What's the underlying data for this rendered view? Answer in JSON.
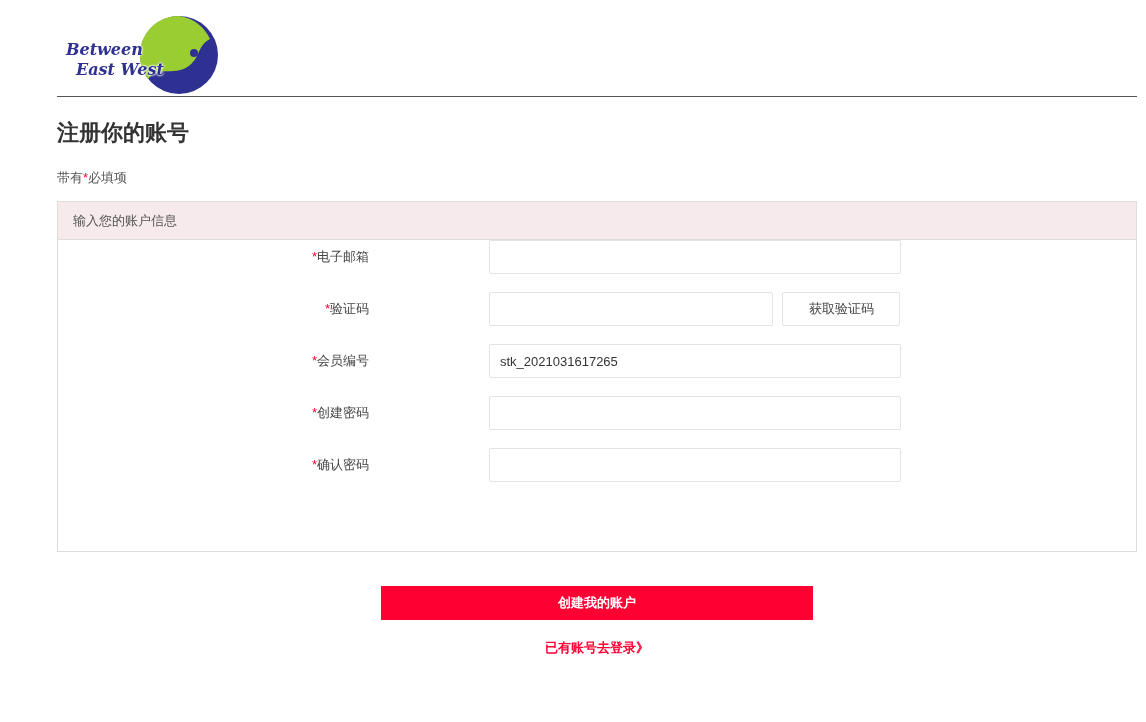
{
  "logo": {
    "line_1": "Between",
    "line_2": "East West"
  },
  "heading": "注册你的账号",
  "required_mark": "*",
  "required_note": {
    "before": "带有",
    "after": "必填项"
  },
  "panel": {
    "title": "输入您的账户信息",
    "fields": [
      {
        "kind": "text",
        "label": "电子邮箱",
        "required": true
      },
      {
        "kind": "code",
        "label": "验证码",
        "required": true,
        "button": "获取验证码"
      },
      {
        "kind": "text",
        "label": "会员编号",
        "required": true,
        "value": "stk_2021031617265"
      },
      {
        "kind": "password",
        "label": "创建密码",
        "required": true
      },
      {
        "kind": "password",
        "label": "确认密码",
        "required": true
      }
    ]
  },
  "submit_button": "创建我的账户",
  "login_link": "已有账号去登录》"
}
